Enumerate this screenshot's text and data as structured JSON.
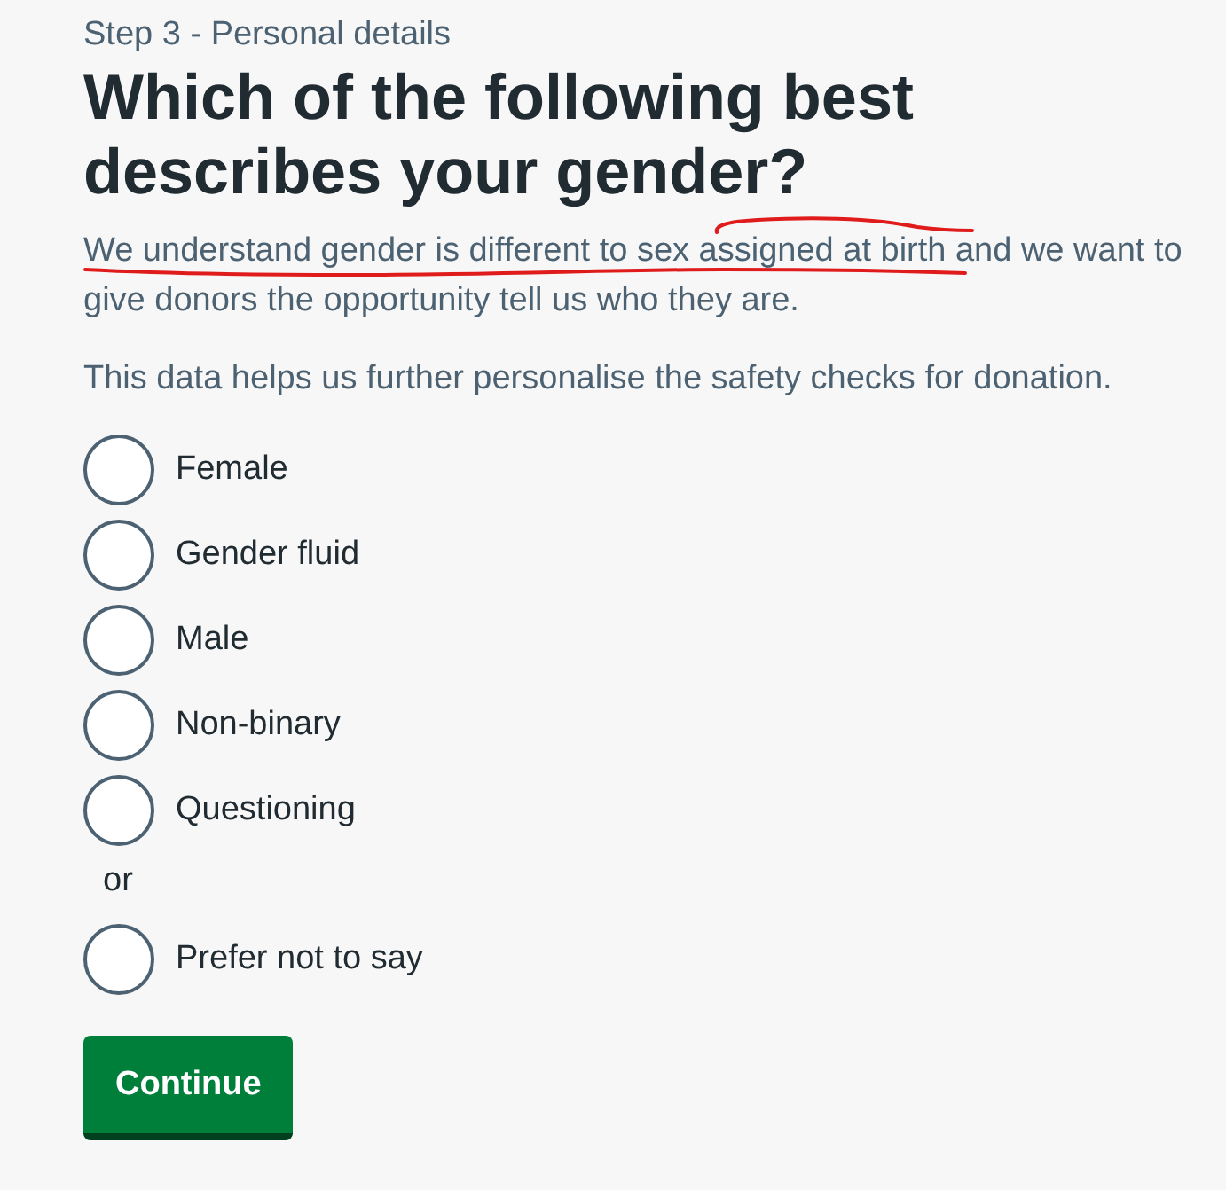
{
  "step": "Step 3 - Personal details",
  "heading": "Which of the following best describes your gender?",
  "intro": [
    {
      "text": "We understand gender is different to sex assigned at birth and we want to give donors the opportunity tell us who they are.",
      "hand_underline": true,
      "hand_arc": true
    },
    {
      "text": "This data helps us further personalise the safety checks for donation."
    }
  ],
  "options": [
    {
      "kind": "radio",
      "label": "Female",
      "selected": false
    },
    {
      "kind": "radio",
      "label": "Gender fluid",
      "selected": false
    },
    {
      "kind": "radio",
      "label": "Male",
      "selected": false
    },
    {
      "kind": "radio",
      "label": "Non-binary",
      "selected": false
    },
    {
      "kind": "radio",
      "label": "Questioning",
      "selected": false
    },
    {
      "kind": "divider",
      "label": "or"
    },
    {
      "kind": "radio",
      "label": "Prefer not to say",
      "selected": false
    }
  ],
  "button": {
    "label": "Continue"
  }
}
